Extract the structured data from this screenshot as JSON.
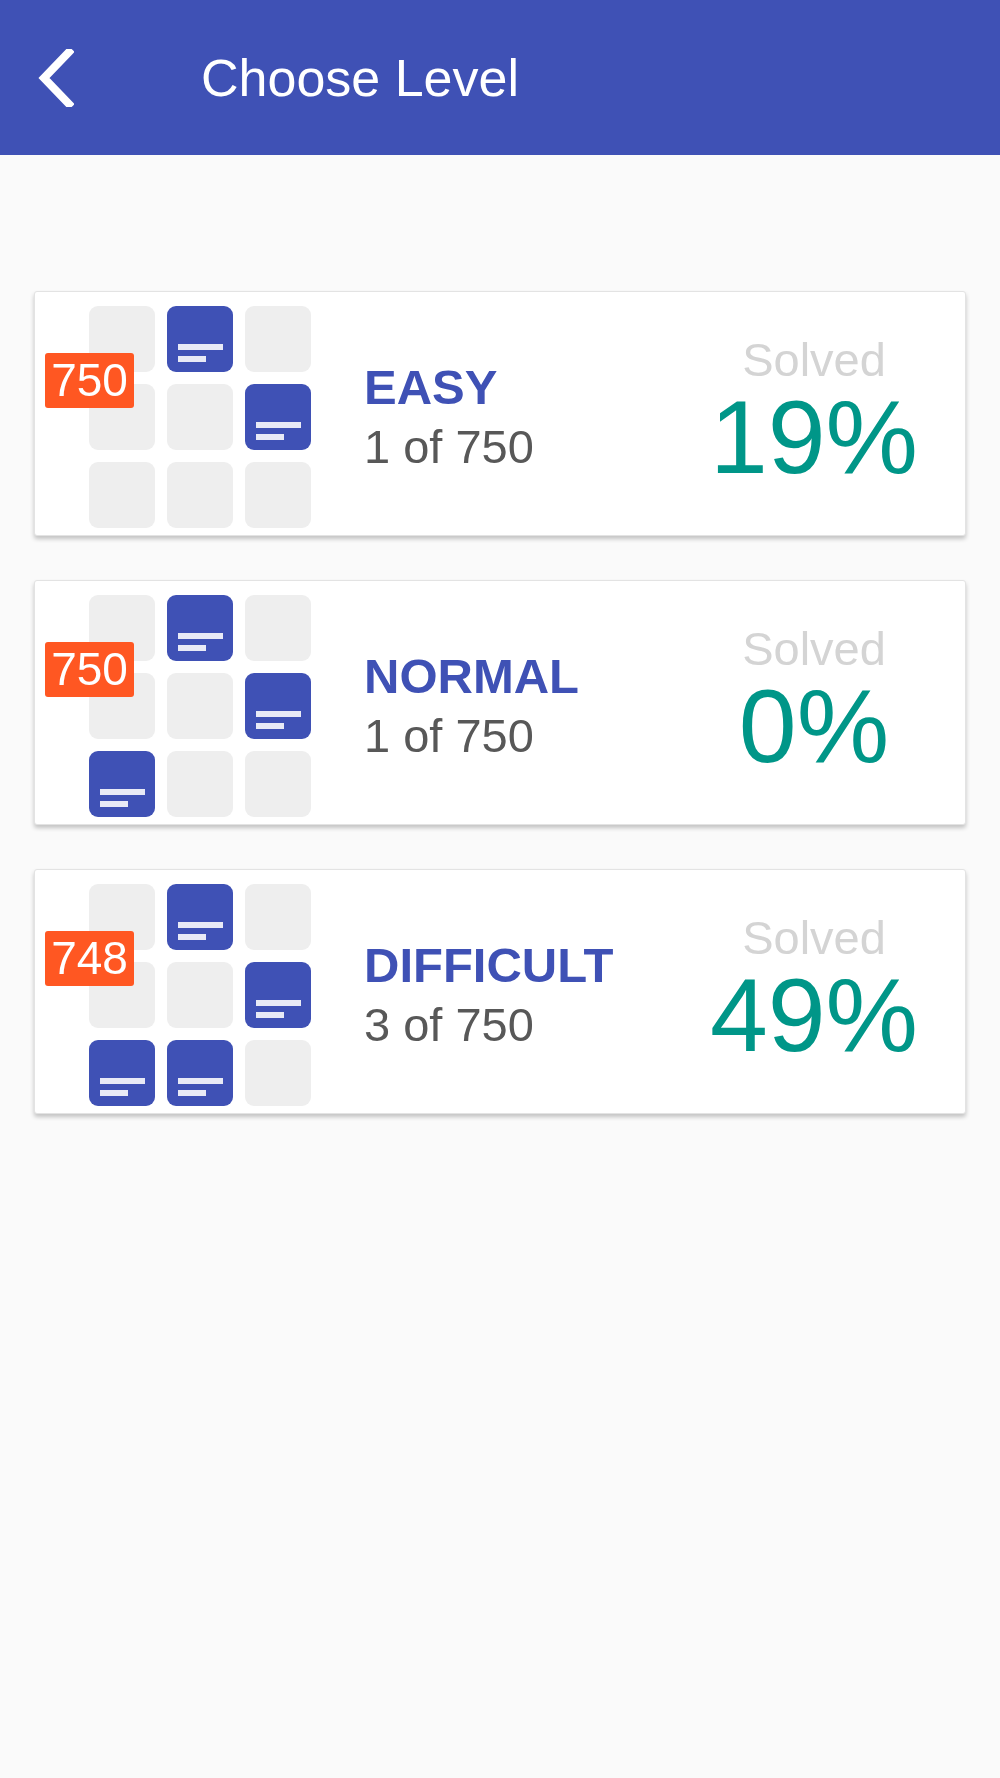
{
  "header": {
    "title": "Choose Level"
  },
  "levels": [
    {
      "badge": "750",
      "name": "EASY",
      "position": "1 of 750",
      "solved_label": "Solved",
      "solved": "19%",
      "tiles": [
        {
          "filled": false
        },
        {
          "filled": true
        },
        {
          "filled": false
        },
        {
          "filled": false
        },
        {
          "filled": false
        },
        {
          "filled": true
        },
        {
          "filled": false
        },
        {
          "filled": false
        },
        {
          "filled": false
        }
      ]
    },
    {
      "badge": "750",
      "name": "NORMAL",
      "position": "1 of 750",
      "solved_label": "Solved",
      "solved": "0%",
      "tiles": [
        {
          "filled": false
        },
        {
          "filled": true
        },
        {
          "filled": false
        },
        {
          "filled": false
        },
        {
          "filled": false
        },
        {
          "filled": true
        },
        {
          "filled": true
        },
        {
          "filled": false
        },
        {
          "filled": false
        }
      ]
    },
    {
      "badge": "748",
      "name": "DIFFICULT",
      "position": "3 of 750",
      "solved_label": "Solved",
      "solved": "49%",
      "tiles": [
        {
          "filled": false
        },
        {
          "filled": true
        },
        {
          "filled": false
        },
        {
          "filled": false
        },
        {
          "filled": false
        },
        {
          "filled": true
        },
        {
          "filled": true
        },
        {
          "filled": true
        },
        {
          "filled": false
        }
      ]
    }
  ]
}
